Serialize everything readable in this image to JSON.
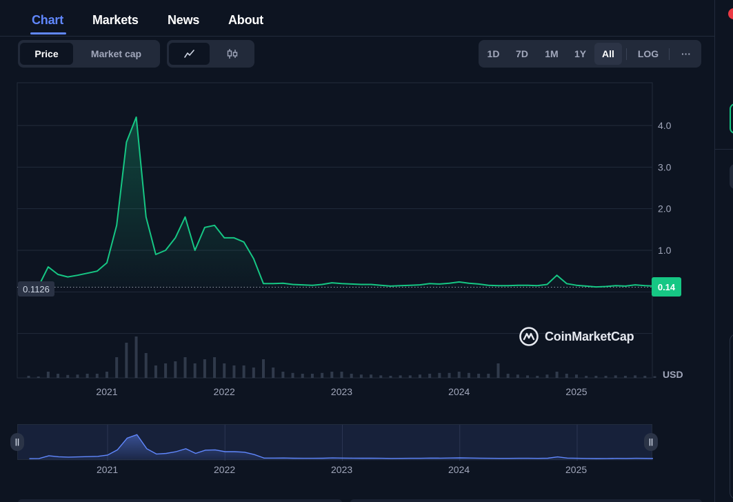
{
  "tabs": [
    "Chart",
    "Markets",
    "News",
    "About"
  ],
  "active_tab": "Chart",
  "metric_toggle": {
    "price": "Price",
    "market_cap": "Market cap",
    "active": "Price"
  },
  "chart_style": {
    "line": "line-chart-icon",
    "candles": "candlestick-icon",
    "active": "line"
  },
  "ranges": {
    "d1": "1D",
    "d7": "7D",
    "m1": "1M",
    "y1": "1Y",
    "all": "All",
    "log": "LOG",
    "more": "···",
    "active": "All"
  },
  "price_badge": "0.14",
  "open_badge": "0.1126",
  "currency": "USD",
  "watermark": "CoinMarketCap",
  "colors": {
    "up": "#16c784",
    "down": "#ea3943",
    "accent": "#6188ff",
    "background": "#0d1421"
  },
  "nav_years": [
    "2021",
    "2022",
    "2023",
    "2024",
    "2025"
  ],
  "chart_data": {
    "type": "line",
    "currency": "USD",
    "x": [
      "2020-05",
      "2020-06",
      "2020-07",
      "2020-08",
      "2020-09",
      "2020-10",
      "2020-11",
      "2020-12",
      "2021-01",
      "2021-02",
      "2021-03",
      "2021-04",
      "2021-05",
      "2021-06",
      "2021-07",
      "2021-08",
      "2021-09",
      "2021-10",
      "2021-11",
      "2021-12",
      "2022-01",
      "2022-02",
      "2022-03",
      "2022-04",
      "2022-05",
      "2022-06",
      "2022-07",
      "2022-08",
      "2022-09",
      "2022-10",
      "2022-11",
      "2022-12",
      "2023-01",
      "2023-02",
      "2023-03",
      "2023-04",
      "2023-05",
      "2023-06",
      "2023-07",
      "2023-08",
      "2023-09",
      "2023-10",
      "2023-11",
      "2023-12",
      "2024-01",
      "2024-02",
      "2024-03",
      "2024-04",
      "2024-05",
      "2024-06",
      "2024-07",
      "2024-08",
      "2024-09",
      "2024-10",
      "2024-11",
      "2024-12",
      "2025-01",
      "2025-02",
      "2025-03",
      "2025-04",
      "2025-05",
      "2025-06",
      "2025-07",
      "2025-08",
      "2025-09"
    ],
    "values": [
      0.11,
      0.13,
      0.6,
      0.42,
      0.36,
      0.4,
      0.45,
      0.5,
      0.7,
      1.6,
      3.6,
      4.2,
      1.8,
      0.9,
      1.0,
      1.3,
      1.8,
      1.0,
      1.55,
      1.6,
      1.3,
      1.3,
      1.2,
      0.8,
      0.2,
      0.2,
      0.21,
      0.18,
      0.17,
      0.16,
      0.18,
      0.22,
      0.2,
      0.19,
      0.18,
      0.18,
      0.16,
      0.14,
      0.15,
      0.16,
      0.17,
      0.2,
      0.19,
      0.21,
      0.24,
      0.21,
      0.19,
      0.16,
      0.15,
      0.15,
      0.16,
      0.16,
      0.15,
      0.18,
      0.4,
      0.2,
      0.16,
      0.14,
      0.12,
      0.13,
      0.15,
      0.14,
      0.17,
      0.15,
      0.14
    ],
    "volume": [
      0.05,
      0.02,
      0.15,
      0.1,
      0.07,
      0.08,
      0.1,
      0.1,
      0.15,
      0.5,
      0.85,
      1.0,
      0.6,
      0.3,
      0.35,
      0.4,
      0.5,
      0.35,
      0.45,
      0.5,
      0.35,
      0.3,
      0.3,
      0.25,
      0.45,
      0.25,
      0.15,
      0.12,
      0.1,
      0.1,
      0.12,
      0.15,
      0.15,
      0.1,
      0.08,
      0.08,
      0.06,
      0.05,
      0.06,
      0.06,
      0.08,
      0.1,
      0.12,
      0.12,
      0.15,
      0.12,
      0.1,
      0.1,
      0.35,
      0.1,
      0.08,
      0.06,
      0.05,
      0.08,
      0.15,
      0.1,
      0.08,
      0.05,
      0.05,
      0.05,
      0.06,
      0.05,
      0.06,
      0.05,
      0.04
    ],
    "y_ticks": [
      1.0,
      2.0,
      3.0,
      4.0
    ],
    "y_tick_labels": [
      "1.0",
      "2.0",
      "3.0",
      "4.0"
    ],
    "x_tick_labels": [
      "2021",
      "2022",
      "2023",
      "2024",
      "2025"
    ],
    "x_tick_dates": [
      "2021-01",
      "2022-01",
      "2023-01",
      "2024-01",
      "2025-01"
    ],
    "ylim": [
      -1.0,
      4.8
    ],
    "reference_line": 0.1126,
    "last_value": 0.14,
    "grid": true,
    "legend": "none"
  }
}
